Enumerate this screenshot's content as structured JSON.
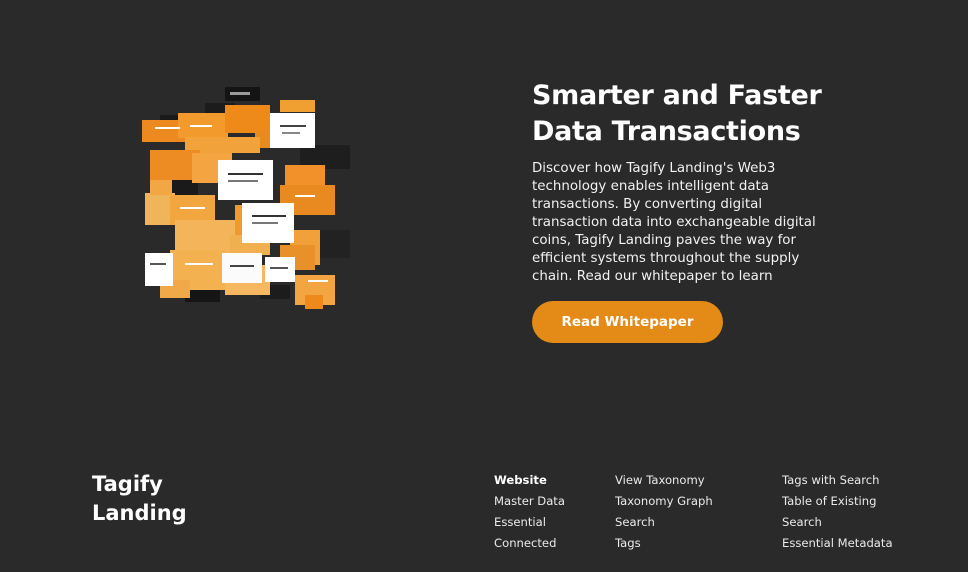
{
  "hero": {
    "title": "Smarter and Faster Data Transactions",
    "description": "Discover how Tagify Landing's Web3 technology enables intelligent data transactions. By converting digital transaction data into exchangeable digital coins, Tagify Landing paves the way for efficient systems throughout the supply chain. Read our whitepaper to learn",
    "cta_label": "Read Whitepaper"
  },
  "footer": {
    "brand_line1": "Tagify",
    "brand_line2": "Landing",
    "col1": [
      "Website",
      "Master Data",
      "Essential",
      "Connected"
    ],
    "col2": [
      "View Taxonomy",
      "Taxonomy Graph",
      "Search",
      "Tags"
    ],
    "col3": [
      "Tags with Search",
      "Table of Existing",
      "Search",
      "Essential Metadata"
    ]
  },
  "colors": {
    "background": "#2a2a2a",
    "accent": "#e48a16"
  }
}
